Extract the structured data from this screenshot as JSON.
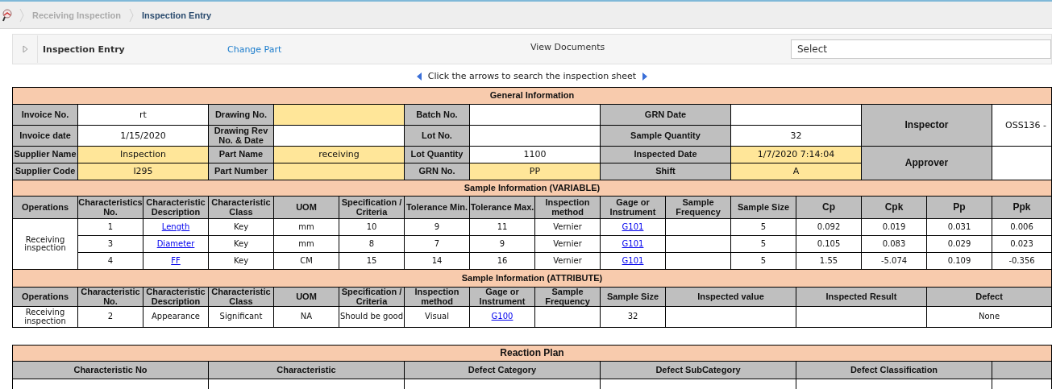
{
  "breadcrumb": [
    {
      "label": "Receiving Inspection",
      "selected": false
    },
    {
      "label": "Inspection Entry",
      "selected": true
    }
  ],
  "panel": {
    "title": "Inspection Entry",
    "change_part_link": "Change Part",
    "view_documents": "View Documents",
    "document_select": {
      "value": "Select"
    }
  },
  "navigator_hint": "Click the arrows to search the inspection sheet",
  "general_information": {
    "title": "General Information",
    "rows": [
      {
        "fields": [
          {
            "label": "Invoice No.",
            "value": "rt",
            "highlighted": false
          },
          {
            "label": "Drawing No.",
            "highlighted": true
          },
          {
            "label": "Batch No.",
            "highlighted": false
          },
          {
            "label": "GRN Date",
            "highlighted": false
          }
        ]
      },
      {
        "fields": [
          {
            "label": "Invoice date",
            "value": "1/15/2020",
            "highlighted": false
          },
          {
            "label": "Drawing Rev No. & Date",
            "highlighted": false
          },
          {
            "label": "Lot No.",
            "highlighted": false
          },
          {
            "label": "Sample Quantity",
            "value": "32",
            "highlighted": false
          }
        ]
      },
      {
        "fields": [
          {
            "label": "Supplier Name",
            "value": "Inspection",
            "highlighted": true
          },
          {
            "label": "Part Name",
            "value": "receiving",
            "highlighted": true
          },
          {
            "label": "Lot Quantity",
            "value": "1100",
            "highlighted": false
          },
          {
            "label": "Inspected Date",
            "value": "1/7/2020 7:14:04",
            "highlighted": true
          }
        ]
      },
      {
        "fields": [
          {
            "label": "Supplier Code",
            "value": "I295",
            "highlighted": true
          },
          {
            "label": "Part Number",
            "highlighted": true
          },
          {
            "label": "GRN No.",
            "value": "PP",
            "highlighted": true
          },
          {
            "label": "Shift",
            "value": "A",
            "highlighted": true
          }
        ]
      }
    ],
    "people": [
      {
        "label": "Inspector",
        "value": "OSS136 -"
      },
      {
        "label": "Approver"
      }
    ]
  },
  "variable_samples": {
    "title": "Sample Information (VARIABLE)",
    "columns": [
      "Operations",
      "Characteristics No.",
      "Characteristic Description",
      "Characteristic Class",
      "UOM",
      "Specification / Criteria",
      "Tolerance Min.",
      "Tolerance Max.",
      "Inspection method",
      "Gage or Instrument",
      "Sample Frequency",
      "Sample Size",
      "Cp",
      "Cpk",
      "Pp",
      "Ppk"
    ],
    "operation": "Receiving inspection",
    "rows": [
      {
        "characteristic_no": "1",
        "description": "Length",
        "class": "Key",
        "uom": "mm",
        "specification": "10",
        "tolerance_min": "9",
        "tolerance_max": "11",
        "method": "Vernier",
        "gage": "G101",
        "sample_size": "5",
        "cp": "0.092",
        "cpk": "0.019",
        "pp": "0.031",
        "ppk": "0.006"
      },
      {
        "characteristic_no": "3",
        "description": "Diameter",
        "class": "Key",
        "uom": "mm",
        "specification": "8",
        "tolerance_min": "7",
        "tolerance_max": "9",
        "method": "Vernier",
        "gage": "G101",
        "sample_size": "5",
        "cp": "0.105",
        "cpk": "0.083",
        "pp": "0.029",
        "ppk": "0.023"
      },
      {
        "characteristic_no": "4",
        "description": "FF",
        "class": "Key",
        "uom": "CM",
        "specification": "15",
        "tolerance_min": "14",
        "tolerance_max": "16",
        "method": "Vernier",
        "gage": "G101",
        "sample_size": "5",
        "cp": "1.55",
        "cpk": "-5.074",
        "pp": "0.109",
        "ppk": "-0.356"
      }
    ]
  },
  "attribute_samples": {
    "title": "Sample Information (ATTRIBUTE)",
    "columns": [
      "Operations",
      "Characteristic No.",
      "Characteristic Description",
      "Characteristic Class",
      "UOM",
      "Specification / Criteria",
      "Inspection method",
      "Gage or Instrument",
      "Sample Frequency",
      "Sample Size",
      "Inspected value",
      "Inspected Result",
      "Defect"
    ],
    "operation": "Receiving inspection",
    "rows": [
      {
        "characteristic_no": "2",
        "description": "Appearance",
        "class": "Significant",
        "uom": "NA",
        "specification": "Should be good",
        "method": "Visual",
        "gage": "G100",
        "sample_size": "32",
        "defect": "None"
      }
    ]
  },
  "reaction_plan": {
    "title": "Reaction Plan",
    "columns": [
      "Characteristic No",
      "Characteristic",
      "Defect Category",
      "Defect SubCategory",
      "Defect Classification"
    ]
  }
}
